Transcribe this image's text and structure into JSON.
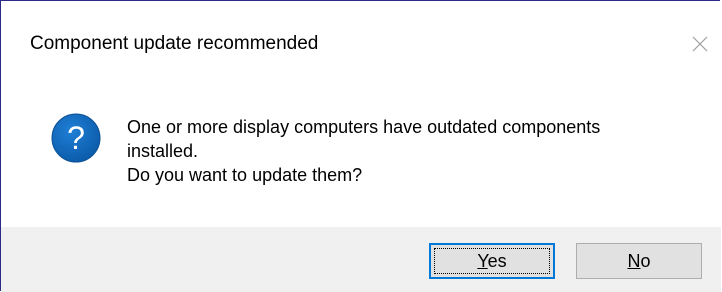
{
  "dialog": {
    "title": "Component update recommended",
    "close_icon": "close-icon",
    "icon": "question-icon",
    "icon_glyph": "?",
    "accent_color": "#0063b1",
    "message_lines": [
      "One or more display computers have outdated components",
      "installed.",
      "Do you want to update them?"
    ],
    "buttons": {
      "yes": {
        "mnemonic": "Y",
        "rest": "es",
        "focused": true
      },
      "no": {
        "mnemonic": "N",
        "rest": "o",
        "focused": false
      }
    }
  }
}
